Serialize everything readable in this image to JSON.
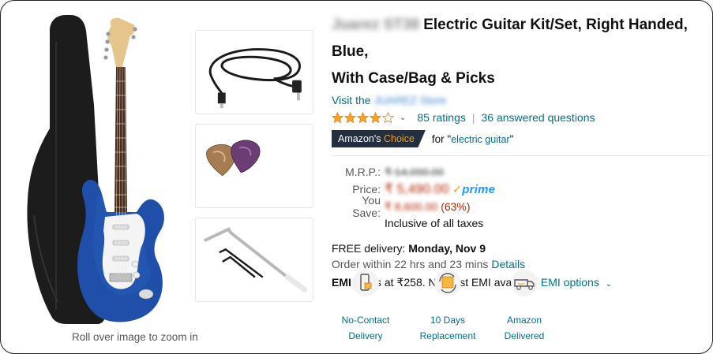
{
  "gallery": {
    "zoom_hint": "Roll over image to zoom in",
    "thumbnails": [
      {
        "name": "cable-thumbnail"
      },
      {
        "name": "picks-thumbnail"
      },
      {
        "name": "tremolo-arm-thumbnail"
      }
    ]
  },
  "product": {
    "brand_blurred": "Juarez ST38",
    "title_part1": "Electric Guitar Kit/Set, Right Handed, Blue,",
    "title_part2": "With Case/Bag & Picks",
    "store_prefix": "Visit the",
    "store_name_blurred": "JUAREZ Store",
    "rating": {
      "stars": 4,
      "ratings_text": "85 ratings",
      "separator": "|",
      "answered_text": "36 answered questions"
    },
    "choice": {
      "badge_1": "Amazon's",
      "badge_2": "Choice",
      "for_text": "for \"",
      "keyword": "electric guitar",
      "close_quote": "\""
    },
    "pricing": {
      "mrp_label": "M.R.P.:",
      "mrp_value": "₹ 14,090.00",
      "price_label": "Price:",
      "price_value": "₹ 5,490.00",
      "prime_check": "✓",
      "prime_word": "prime",
      "save_label": "You Save:",
      "save_amount": "₹ 8,600.00",
      "save_percent": "(63%)",
      "tax_note": "Inclusive of all taxes"
    },
    "delivery": {
      "free_text": "FREE delivery:",
      "date": "Monday, Nov 9",
      "order_within": "Order within 22 hrs and 23 mins",
      "details_link": "Details"
    },
    "emi": {
      "emi_word": "EMI",
      "text": "starts at ₹258. No Cost EMI available",
      "link": "EMI options"
    },
    "features": [
      {
        "line1": "No-Contact",
        "line2": "Delivery",
        "icon": "no-contact-delivery-icon"
      },
      {
        "line1": "10 Days",
        "line2": "Replacement",
        "icon": "replacement-icon"
      },
      {
        "line1": "Amazon",
        "line2": "Delivered",
        "icon": "amazon-delivered-icon"
      }
    ]
  },
  "colors": {
    "link": "#007185",
    "price": "#b12704",
    "badge_bg": "#232f3e",
    "badge_accent": "#ff9900",
    "star": "#ffa41c",
    "prime_blue": "#1a98ff"
  }
}
